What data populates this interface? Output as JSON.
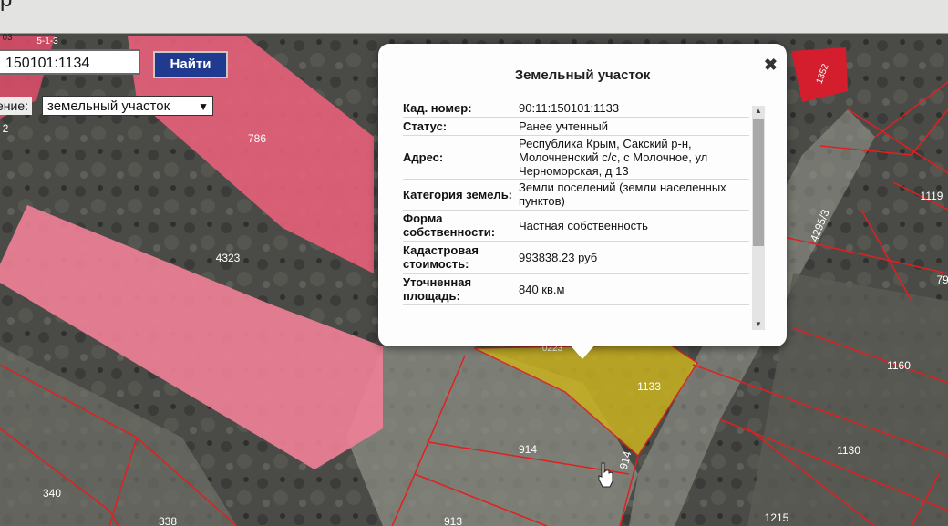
{
  "header": {
    "title_fragment": "р"
  },
  "search": {
    "value": "150101:1134",
    "button_label": "Найти"
  },
  "layer": {
    "label": "ение:",
    "selected": "земельный участок"
  },
  "map": {
    "labels": {
      "corner_top": "03",
      "corner_top2": "5-1-3",
      "left_edge_2": "2",
      "p786": "786",
      "p4323": "4323",
      "p4295": "4295/3",
      "p1119": "1119",
      "p79": "79",
      "p1160": "1160",
      "p1133": "1133",
      "p0223": "0223",
      "p914a": "914",
      "p914b": "914",
      "p1130": "1130",
      "p340": "340",
      "p338": "338",
      "p913": "913",
      "p1215": "1215",
      "p1352": "1352"
    }
  },
  "popup": {
    "title": "Земельный участок",
    "close_icon": "close-icon",
    "rows": [
      {
        "label": "Кад. номер:",
        "value": "90:11:150101:1133"
      },
      {
        "label": "Статус:",
        "value": "Ранее учтенный"
      },
      {
        "label": "Адрес:",
        "value": "Республика Крым, Сакский р-н, Молочненский с/с, с Молочное, ул Черноморская, д 13"
      },
      {
        "label": "Категория земель:",
        "value": "Земли поселений (земли населенных пунктов)"
      },
      {
        "label": "Форма собственности:",
        "value": "Частная собственность"
      },
      {
        "label": "Кадастровая стоимость:",
        "value": "993838.23 руб"
      },
      {
        "label": "Уточненная площадь:",
        "value": "840 кв.м"
      }
    ]
  },
  "colors": {
    "parcel_pink": "#e8607a",
    "parcel_selected": "#c9b21f",
    "boundary_red": "#e02020",
    "button_blue": "#1f3a8f"
  }
}
